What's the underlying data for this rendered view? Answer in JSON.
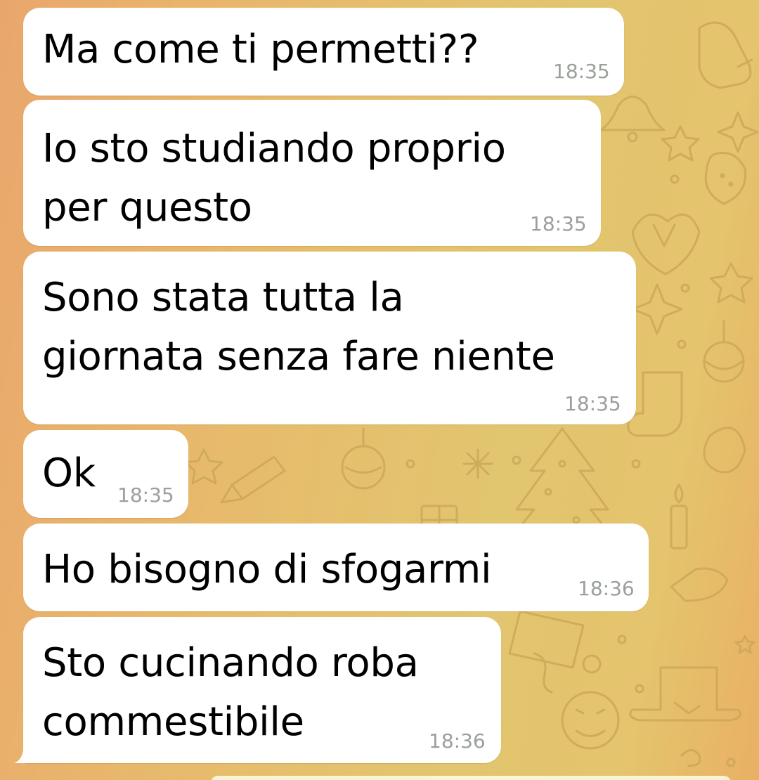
{
  "chat": {
    "messages": [
      {
        "text": "Ma come ti permetti??",
        "time": "18:35"
      },
      {
        "text": "Io sto studiando proprio\nper questo",
        "time": "18:35"
      },
      {
        "text": "Sono stata tutta la\ngiornata senza fare niente",
        "time": "18:35"
      },
      {
        "text": "Ok",
        "time": "18:35"
      },
      {
        "text": "Ho bisogno di sfogarmi",
        "time": "18:36"
      },
      {
        "text": "Sto cucinando roba\ncommestibile",
        "time": "18:36"
      }
    ]
  },
  "theme": {
    "bubble_color": "#ffffff",
    "text_color": "#000000",
    "time_color": "#9aa09a",
    "wallpaper_doodles": [
      "mitten-icon",
      "bell-icon",
      "star-icon",
      "strawberry-icon",
      "heart-box-icon",
      "sparkle-icon",
      "ornament-icon",
      "stocking-icon",
      "christmas-tree-icon",
      "snowflake-icon",
      "candle-icon",
      "top-hat-icon",
      "smiley-face-icon",
      "ribbon-icon"
    ]
  }
}
